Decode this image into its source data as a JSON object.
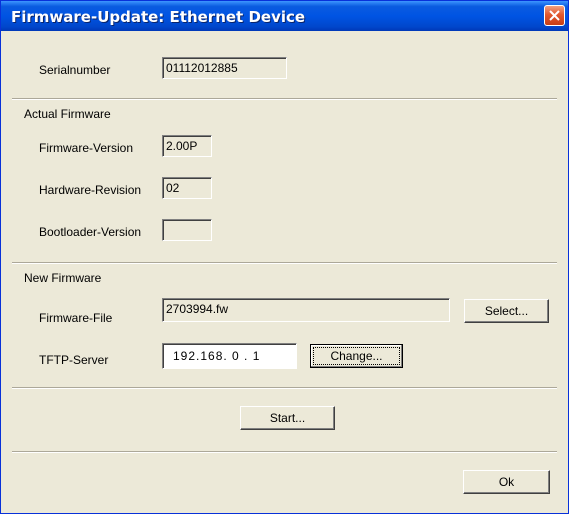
{
  "window": {
    "title": "Firmware-Update: Ethernet Device"
  },
  "serial": {
    "label": "Serialnumber",
    "value": "01112012885"
  },
  "actual_firmware": {
    "heading": "Actual Firmware",
    "firmware_version": {
      "label": "Firmware-Version",
      "value": "2.00P"
    },
    "hardware_revision": {
      "label": "Hardware-Revision",
      "value": "02"
    },
    "bootloader_version": {
      "label": "Bootloader-Version",
      "value": ""
    }
  },
  "new_firmware": {
    "heading": "New Firmware",
    "firmware_file": {
      "label": "Firmware-File",
      "value": "2703994.fw",
      "button": "Select..."
    },
    "tftp_server": {
      "label": "TFTP-Server",
      "value": "192.168. 0 . 1",
      "button": "Change..."
    }
  },
  "actions": {
    "start": "Start...",
    "ok": "Ok"
  },
  "icons": {
    "close": "close-icon"
  },
  "colors": {
    "titlebar": "#0054e3",
    "dialog_bg": "#ece9d8",
    "close_button": "#e2582f"
  }
}
